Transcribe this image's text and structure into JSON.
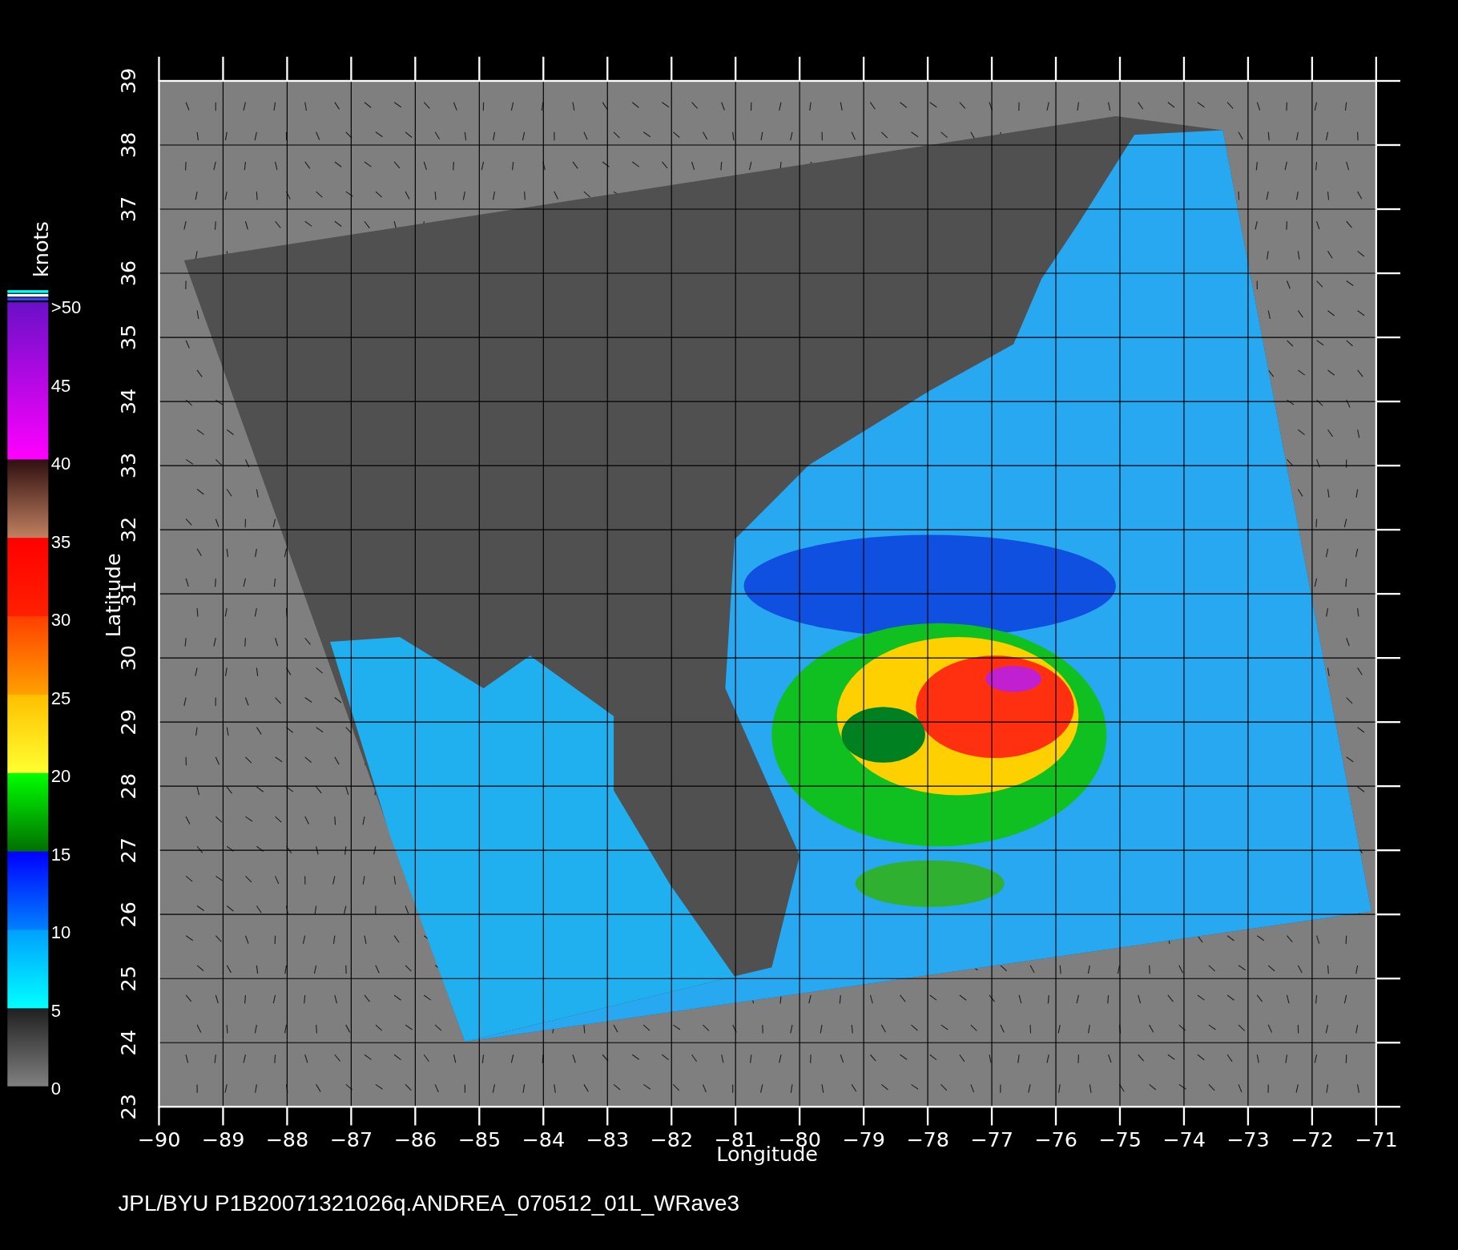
{
  "x_axis": {
    "title": "Longitude",
    "tick_labels": [
      "−90",
      "−89",
      "−88",
      "−87",
      "−86",
      "−85",
      "−84",
      "−83",
      "−82",
      "−81",
      "−80",
      "−79",
      "−78",
      "−77",
      "−76",
      "−75",
      "−74",
      "−73",
      "−72",
      "−71"
    ]
  },
  "y_axis": {
    "title": "Latitude",
    "tick_labels": [
      "23",
      "24",
      "25",
      "26",
      "27",
      "28",
      "29",
      "30",
      "31",
      "32",
      "33",
      "34",
      "35",
      "36",
      "37",
      "38",
      "39"
    ]
  },
  "color_scale": {
    "unit": "knots",
    "labels": [
      ">50",
      "45",
      "40",
      "35",
      "30",
      "25",
      "20",
      "15",
      "10",
      "5",
      "0"
    ]
  },
  "caption": "JPL/BYU  P1B20071321026q.ANDREA_070512_01L_WRave3"
}
